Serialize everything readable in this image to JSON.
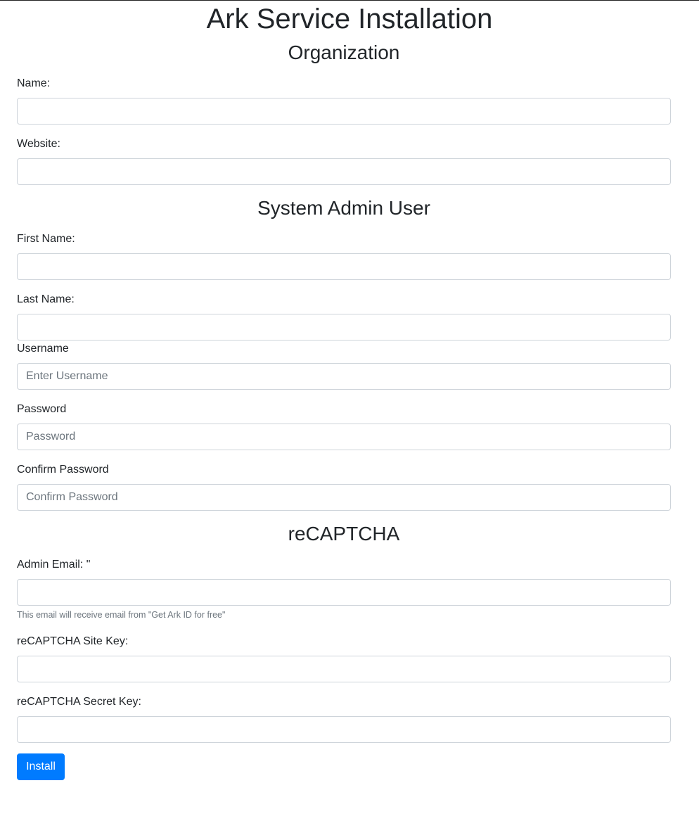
{
  "page": {
    "title": "Ark Service Installation"
  },
  "organization": {
    "heading": "Organization",
    "name_label": "Name:",
    "name_value": "",
    "website_label": "Website:",
    "website_value": ""
  },
  "admin_user": {
    "heading": "System Admin User",
    "first_name_label": "First Name:",
    "first_name_value": "",
    "last_name_label": "Last Name:",
    "last_name_value": "",
    "username_label": "Username",
    "username_placeholder": "Enter Username",
    "password_label": "Password",
    "password_placeholder": "Password",
    "confirm_password_label": "Confirm Password",
    "confirm_password_placeholder": "Confirm Password"
  },
  "recaptcha": {
    "heading": "reCAPTCHA",
    "admin_email_label": "Admin Email: \"",
    "admin_email_value": "",
    "admin_email_help": "This email will receive email from \"Get Ark ID for free\"",
    "site_key_label": "reCAPTCHA Site Key:",
    "site_key_value": "",
    "secret_key_label": "reCAPTCHA Secret Key:",
    "secret_key_value": ""
  },
  "actions": {
    "install_label": "Install"
  },
  "colors": {
    "primary": "#007bff",
    "text": "#212529",
    "muted": "#6c757d",
    "input_border": "#ced4da"
  }
}
